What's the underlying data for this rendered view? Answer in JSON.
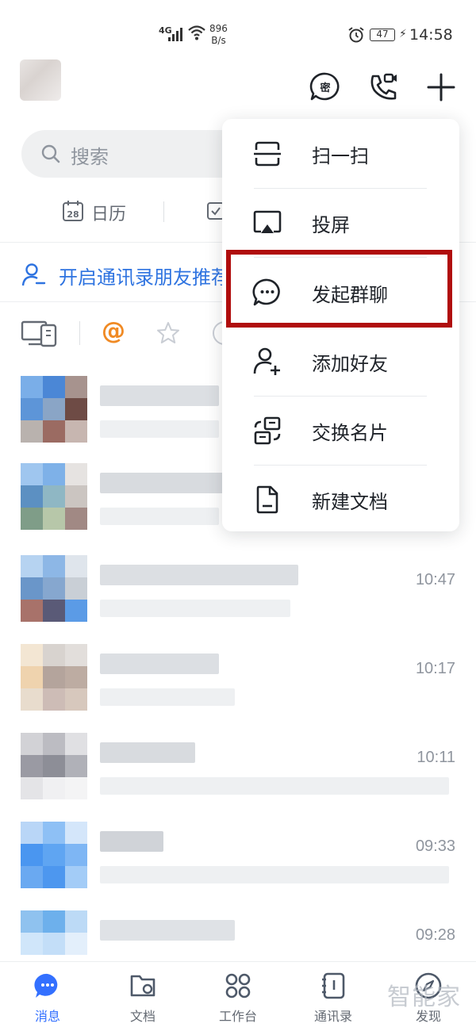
{
  "status_bar": {
    "network": "4G",
    "speed_value": "896",
    "speed_unit": "B/s",
    "battery": "47",
    "time": "14:58"
  },
  "search": {
    "placeholder": "搜索"
  },
  "quick_tools": {
    "calendar_label": "日历",
    "calendar_date": "28"
  },
  "banner": {
    "text": "开启通讯录朋友推荐"
  },
  "filters": {
    "mention": "@"
  },
  "chat_times": [
    "10:47",
    "10:17",
    "10:11",
    "09:33",
    "09:28"
  ],
  "menu": {
    "items": [
      {
        "label": "扫一扫",
        "icon": "scan-icon"
      },
      {
        "label": "投屏",
        "icon": "screen-cast-icon"
      },
      {
        "label": "发起群聊",
        "icon": "chat-bubble-icon"
      },
      {
        "label": "添加好友",
        "icon": "add-friend-icon"
      },
      {
        "label": "交换名片",
        "icon": "exchange-card-icon"
      },
      {
        "label": "新建文档",
        "icon": "document-icon"
      }
    ],
    "highlighted": "发起群聊",
    "highlight_color": "#b00d0d"
  },
  "bottom_nav": {
    "items": [
      {
        "label": "消息",
        "icon": "message-icon",
        "active": true
      },
      {
        "label": "文档",
        "icon": "folder-icon"
      },
      {
        "label": "工作台",
        "icon": "workspace-icon"
      },
      {
        "label": "通讯录",
        "icon": "contacts-icon"
      },
      {
        "label": "发现",
        "icon": "compass-icon"
      }
    ]
  },
  "watermark": "智能家",
  "colors": {
    "accent": "#3370ff",
    "banner": "#2e73e0",
    "mention": "#f08a24"
  }
}
